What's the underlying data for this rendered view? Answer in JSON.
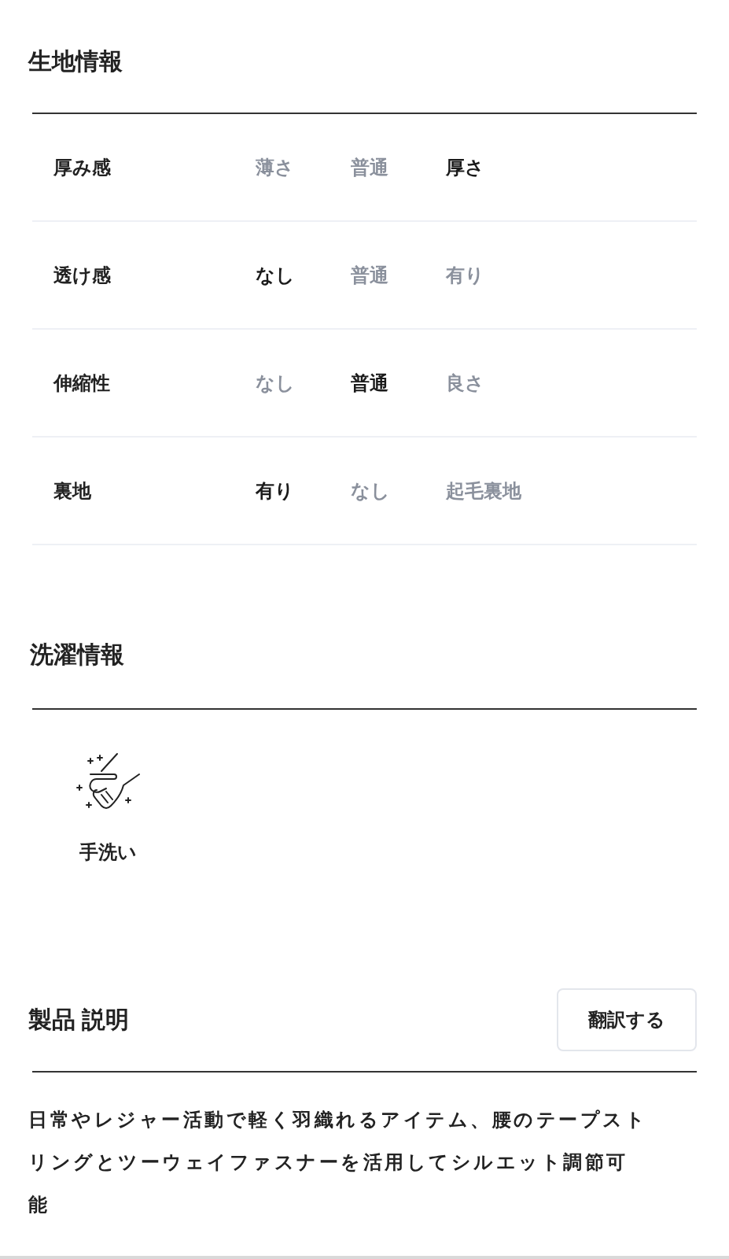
{
  "fabric": {
    "title": "生地情報",
    "rows": [
      {
        "label": "厚み感",
        "options": [
          {
            "label": "薄さ",
            "selected": false
          },
          {
            "label": "普通",
            "selected": false
          },
          {
            "label": "厚さ",
            "selected": true
          }
        ]
      },
      {
        "label": "透け感",
        "options": [
          {
            "label": "なし",
            "selected": true
          },
          {
            "label": "普通",
            "selected": false
          },
          {
            "label": "有り",
            "selected": false
          }
        ]
      },
      {
        "label": "伸縮性",
        "options": [
          {
            "label": "なし",
            "selected": false
          },
          {
            "label": "普通",
            "selected": true
          },
          {
            "label": "良さ",
            "selected": false
          }
        ]
      },
      {
        "label": "裏地",
        "options": [
          {
            "label": "有り",
            "selected": true
          },
          {
            "label": "なし",
            "selected": false
          },
          {
            "label": "起毛裏地",
            "selected": false
          }
        ]
      }
    ]
  },
  "washing": {
    "title": "洗濯情報",
    "items": [
      {
        "label": "手洗い"
      }
    ]
  },
  "description": {
    "title": "製品 説明",
    "translate_button": "翻訳する",
    "text": "日常やレジャー活動で軽く羽織れるアイテム、腰のテープストリングとツーウェイファスナーを活用してシルエット調節可能"
  }
}
